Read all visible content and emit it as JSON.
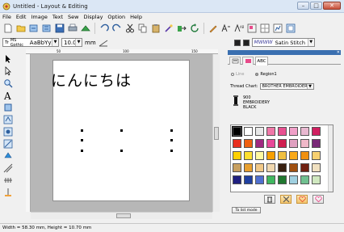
{
  "window": {
    "title": "Untitled - Layout & Editing",
    "minimize": "–",
    "maximize": "□",
    "close": "✕"
  },
  "menu": [
    "File",
    "Edit",
    "Image",
    "Text",
    "Sew",
    "Display",
    "Option",
    "Help"
  ],
  "toolbar_icons": [
    "new-file-icon",
    "open-folder-icon",
    "import-icon",
    "export-icon",
    "save-icon",
    "print-icon",
    "send-icon",
    "undo-icon",
    "redo-icon",
    "cut-icon",
    "copy-icon",
    "paste-icon",
    "magic-wand-icon",
    "transfer-icon",
    "rotate-icon",
    "pencil-icon",
    "stitch-font-icon",
    "text-font-icon",
    "layout-icon",
    "grid-icon",
    "chart-icon",
    "frame-icon"
  ],
  "text_toolbar": {
    "font_prefix": "Tr",
    "font_name": "MS Gothic",
    "font_sample": "AaBbYyZz",
    "size": "10.0",
    "unit": "mm",
    "stitch_type": "Satin Stitch"
  },
  "canvas": {
    "text": "にんにちは"
  },
  "ruler": {
    "marks": [
      "50",
      "100",
      "150"
    ]
  },
  "panel": {
    "tabs": [
      "line-tab",
      "region-tab",
      "ABC"
    ],
    "line_radio": "Line",
    "region_radio": "Region1",
    "thread_chart_label": "Thread Chart:",
    "thread_chart_value": "BROTHER EMBROIDERY",
    "thread_number": "900",
    "thread_brand": "EMBROIDERY",
    "thread_color_name": "BLACK",
    "to_list_mode": "To list mode"
  },
  "swatch_colors": [
    "#000000",
    "#ffffff",
    "#e8e8e8",
    "#f078a8",
    "#e85090",
    "#f0a0c8",
    "#e8b8d0",
    "#d02060",
    "#e83020",
    "#f06010",
    "#a02880",
    "#e84898",
    "#d02050",
    "#e0a0c0",
    "#f0b8c8",
    "#7a2878",
    "#ffd000",
    "#ffe030",
    "#fff8a0",
    "#f8a000",
    "#f0c040",
    "#f8a818",
    "#f09010",
    "#f8d070",
    "#c8a060",
    "#e8a030",
    "#f0c888",
    "#f0d8b0",
    "#382010",
    "#a05010",
    "#702010",
    "#f0e0c0",
    "#202080",
    "#2040a0",
    "#5070d0",
    "#40b860",
    "#207830",
    "#a0d0e0",
    "#70c090",
    "#d0e8c0"
  ],
  "status": {
    "text": "Width = 58.30 mm, Height = 10.70 mm"
  },
  "colors": {
    "accent": "#3a6fb0",
    "canvas_bg": "#b7b7b7",
    "panel_title": "#3a6fb0"
  }
}
